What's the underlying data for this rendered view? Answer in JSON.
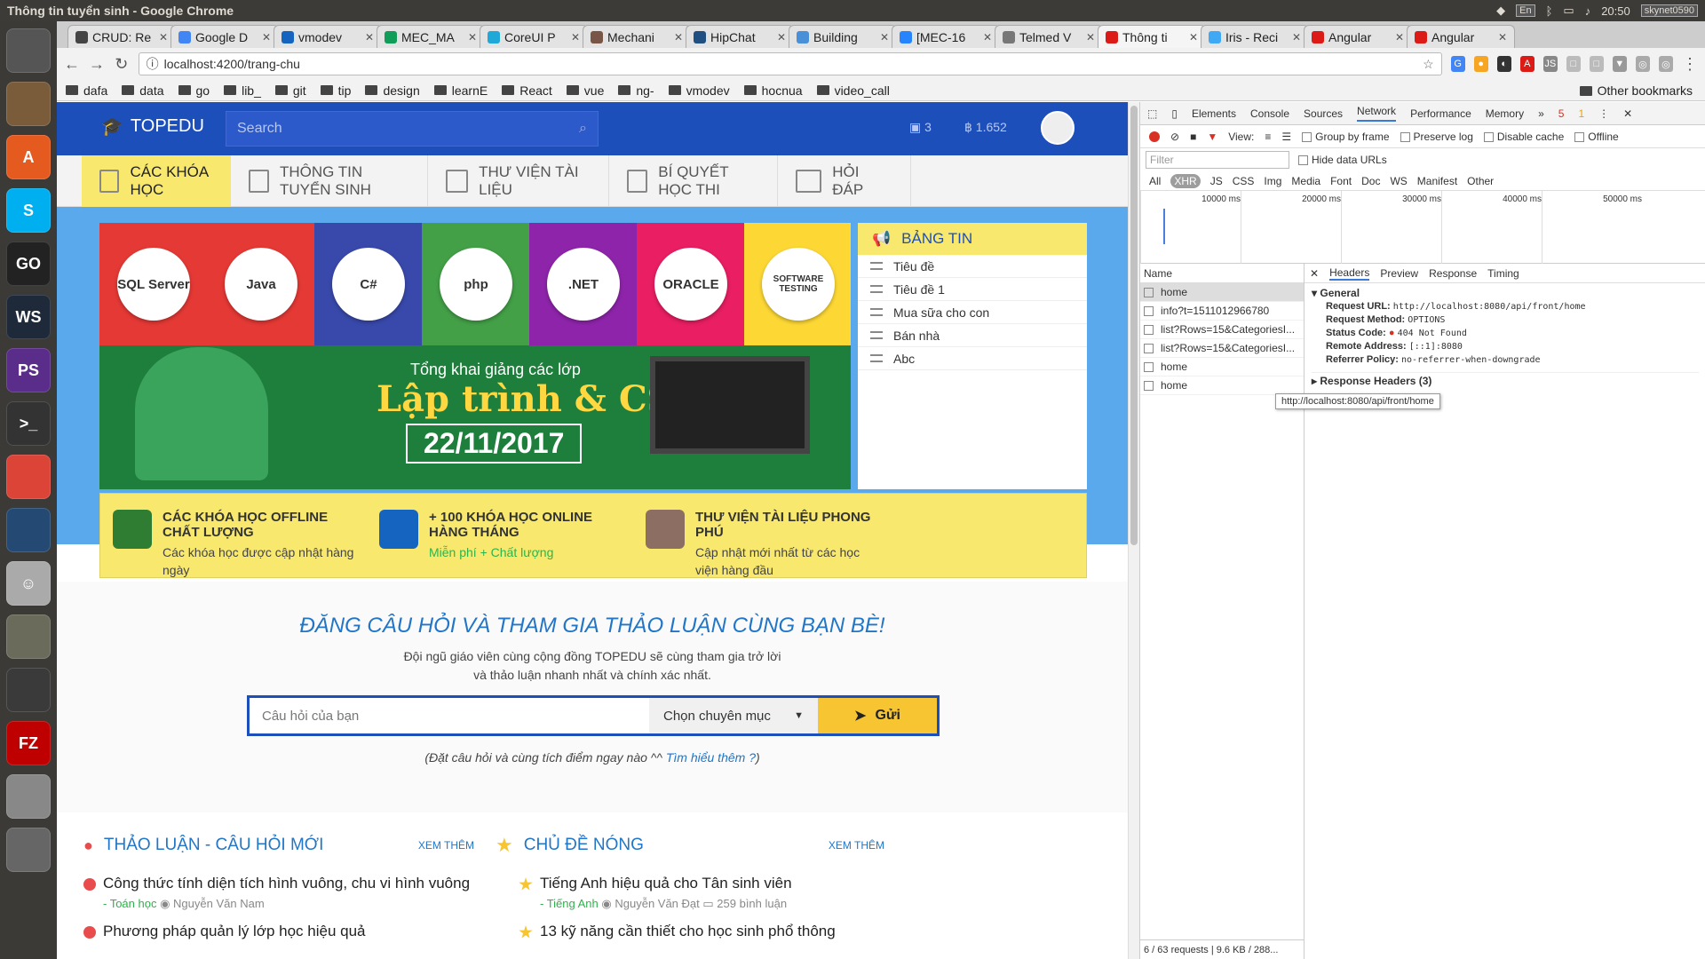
{
  "os": {
    "window_title": "Thông tin tuyển sinh - Google Chrome",
    "lang": "En",
    "time": "20:50",
    "user": "skynet0590"
  },
  "launcher": [
    {
      "name": "ubuntu-icon",
      "label": "",
      "color": "#555"
    },
    {
      "name": "files-icon",
      "label": "",
      "color": "#7a5b3a"
    },
    {
      "name": "software-center-icon",
      "label": "A",
      "color": "#e55b1f"
    },
    {
      "name": "skype-icon",
      "label": "S",
      "color": "#00aff0"
    },
    {
      "name": "goland-icon",
      "label": "GO",
      "color": "#222"
    },
    {
      "name": "webstorm-icon",
      "label": "WS",
      "color": "#1e2a3a"
    },
    {
      "name": "phpstorm-icon",
      "label": "PS",
      "color": "#5b2d8a"
    },
    {
      "name": "terminal-icon",
      "label": ">_",
      "color": "#333"
    },
    {
      "name": "chrome-icon",
      "label": "",
      "color": "#db4437"
    },
    {
      "name": "mysql-workbench-icon",
      "label": "",
      "color": "#244a73"
    },
    {
      "name": "pidgin-icon",
      "label": "☺",
      "color": "#aaa"
    },
    {
      "name": "gimp-icon",
      "label": "",
      "color": "#6b6b5b"
    },
    {
      "name": "sublime-icon",
      "label": "",
      "color": "#3a3a3a"
    },
    {
      "name": "filezilla-icon",
      "label": "FZ",
      "color": "#bf0000"
    },
    {
      "name": "disk-icon",
      "label": "",
      "color": "#888"
    },
    {
      "name": "trash-icon",
      "label": "",
      "color": "#666"
    }
  ],
  "tabs": [
    {
      "label": "CRUD: Re",
      "color": "#444"
    },
    {
      "label": "Google D",
      "color": "#4285f4"
    },
    {
      "label": "vmodev",
      "color": "#1565c0"
    },
    {
      "label": "MEC_MA",
      "color": "#0f9d58"
    },
    {
      "label": "CoreUI P",
      "color": "#20a8d8"
    },
    {
      "label": "Mechani",
      "color": "#795548"
    },
    {
      "label": "HipChat",
      "color": "#205081"
    },
    {
      "label": "Building",
      "color": "#4a90d9"
    },
    {
      "label": "[MEC-16",
      "color": "#2684ff"
    },
    {
      "label": "Telmed V",
      "color": "#777"
    },
    {
      "label": "Thông ti",
      "color": "#dd1b16",
      "active": true
    },
    {
      "label": "Iris - Reci",
      "color": "#3fa9f5"
    },
    {
      "label": "Angular",
      "color": "#dd1b16"
    },
    {
      "label": "Angular",
      "color": "#dd1b16"
    }
  ],
  "address": {
    "url": "localhost:4200/trang-chu"
  },
  "bookmarks": [
    "dafa",
    "data",
    "go",
    "lib_",
    "git",
    "tip",
    "design",
    "learnE",
    "React",
    "vue",
    "ng-",
    "vmodev",
    "hocnua",
    "video_call"
  ],
  "other_bookmarks": "Other bookmarks",
  "site": {
    "logo": "TOPEDU",
    "search_placeholder": "Search",
    "cart_count": "3",
    "coin_count": "1.652",
    "menu": [
      "CÁC KHÓA HỌC",
      "THÔNG TIN TUYỂN SINH",
      "THƯ VIỆN TÀI LIỆU",
      "BÍ QUYẾT HỌC THI",
      "HỎI ĐÁP"
    ],
    "banner": {
      "tiles": [
        {
          "label": "SQL Server",
          "color": "#e53935"
        },
        {
          "label": "Java",
          "color": "#e53935"
        },
        {
          "label": "C#",
          "color": "#3949ab"
        },
        {
          "label": "php",
          "color": "#43a047"
        },
        {
          "label": ".NET",
          "color": "#8e24aa"
        },
        {
          "label": "ORACLE",
          "color": "#e91e63"
        },
        {
          "label": "SOFTWARE TESTING",
          "color": "#fdd835"
        }
      ],
      "line1": "Tổng khai giảng các lớp",
      "line2": "Lập trình & CSDL",
      "date": "22/11/2017"
    },
    "news": {
      "title": "BẢNG TIN",
      "items": [
        "Tiêu đề",
        "Tiêu đề 1",
        "Mua sữa cho con",
        "Bán nhà",
        "Abc"
      ]
    },
    "features": [
      {
        "title": "CÁC KHÓA HỌC OFFLINE CHẤT LƯỢNG",
        "desc": "Các khóa học được cập nhật hàng ngày",
        "color": "#2e7d32"
      },
      {
        "title": "+ 100 KHÓA HỌC ONLINE HÀNG THÁNG",
        "desc": "Miễn phí + Chất lượng",
        "color": "#1565c0"
      },
      {
        "title": "THƯ VIỆN TÀI LIỆU PHONG PHÚ",
        "desc": "Cập nhật mới nhất từ các học viện hàng đầu",
        "color": "#8d6e63"
      }
    ],
    "ask": {
      "title": "ĐĂNG CÂU HỎI VÀ THAM GIA THẢO LUẬN CÙNG BẠN BÈ!",
      "sub1": "Đội ngũ giáo viên cùng cộng đồng TOPEDU sẽ cùng tham gia trở lời",
      "sub2": "và thảo luận nhanh nhất và chính xác nhất.",
      "placeholder": "Câu hỏi của bạn",
      "category": "Chọn chuyên mục",
      "submit": "Gửi",
      "note": "(Đặt câu hỏi và cùng tích điểm ngay nào ^^",
      "note_link": "Tìm hiểu thêm",
      "note_end": ")"
    },
    "discuss": {
      "title": "THẢO LUẬN - CÂU HỎI MỚI",
      "more": "XEM THÊM",
      "items": [
        {
          "title": "Công thức tính diện tích hình vuông, chu vi hình vuông",
          "subject": "- Toán học",
          "author": "Nguyễn Văn Nam"
        },
        {
          "title": "Phương pháp quản lý lớp học hiệu quả",
          "subject": "",
          "author": ""
        }
      ]
    },
    "hot": {
      "title": "CHỦ ĐỀ NÓNG",
      "more": "XEM THÊM",
      "items": [
        {
          "title": "Tiếng Anh hiệu quả cho Tân sinh viên",
          "subject": "- Tiếng Anh",
          "author": "Nguyễn Văn Đạt",
          "comments": "259 bình luận"
        },
        {
          "title": "13 kỹ năng cần thiết cho học sinh phổ thông",
          "subject": "",
          "author": "",
          "comments": ""
        }
      ]
    }
  },
  "devtools": {
    "tabs": [
      "Elements",
      "Console",
      "Sources",
      "Network",
      "Performance",
      "Memory"
    ],
    "errors": "5",
    "warnings": "1",
    "toolbar": {
      "view": "View:",
      "group": "Group by frame",
      "preserve": "Preserve log",
      "disable_cache": "Disable cache",
      "offline": "Offline"
    },
    "filter_placeholder": "Filter",
    "hide_data": "Hide data URLs",
    "types": [
      "All",
      "XHR",
      "JS",
      "CSS",
      "Img",
      "Media",
      "Font",
      "Doc",
      "WS",
      "Manifest",
      "Other"
    ],
    "timeline": [
      "10000 ms",
      "20000 ms",
      "30000 ms",
      "40000 ms",
      "50000 ms"
    ],
    "name_col": "Name",
    "requests": [
      "home",
      "info?t=1511012966780",
      "list?Rows=15&CategoriesI...",
      "list?Rows=15&CategoriesI...",
      "home",
      "home"
    ],
    "footer": "6 / 63 requests | 9.6 KB / 288...",
    "detail_tabs": [
      "Headers",
      "Preview",
      "Response",
      "Timing"
    ],
    "general": {
      "title": "General",
      "rows": [
        {
          "k": "Request URL:",
          "v": "http://localhost:8080/api/front/home"
        },
        {
          "k": "Request Method:",
          "v": "OPTIONS"
        },
        {
          "k": "Status Code:",
          "v": "404 Not Found"
        },
        {
          "k": "Remote Address:",
          "v": "[::1]:8080"
        },
        {
          "k": "Referrer Policy:",
          "v": "no-referrer-when-downgrade"
        }
      ]
    },
    "response_headers": "Response Headers (3)",
    "tooltip": "http://localhost:8080/api/front/home"
  }
}
